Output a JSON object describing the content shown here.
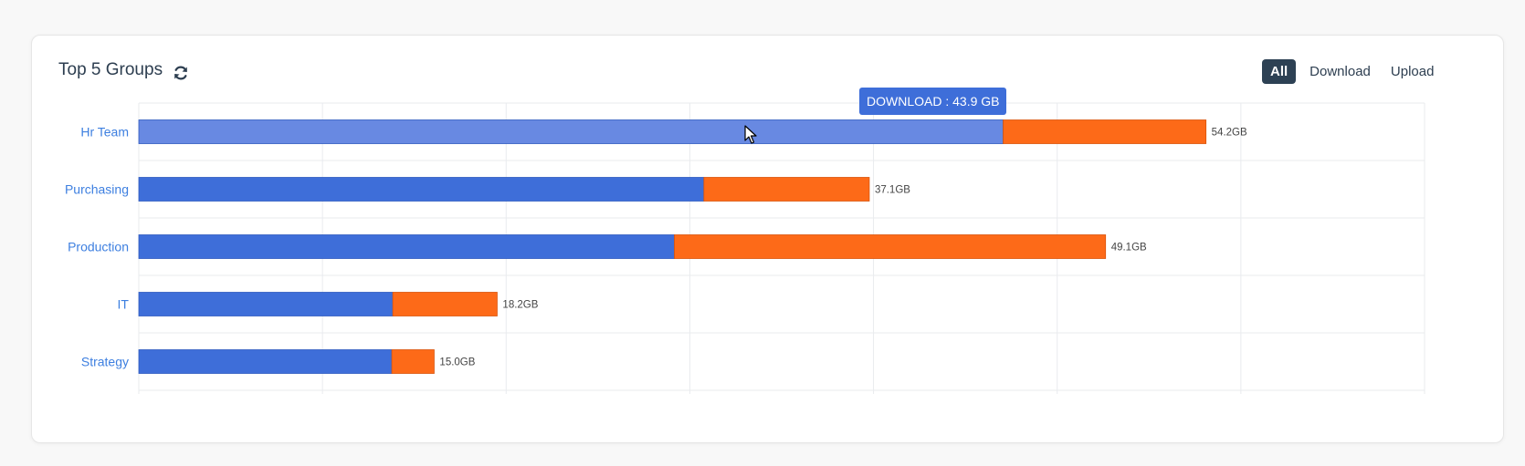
{
  "header": {
    "title": "Top 5 Groups",
    "refresh_icon": "refresh-icon"
  },
  "filters": [
    {
      "label": "All",
      "active": true
    },
    {
      "label": "Download",
      "active": false
    },
    {
      "label": "Upload",
      "active": false
    }
  ],
  "tooltip": {
    "text": "DOWNLOAD : 43.9 GB"
  },
  "colors": {
    "download": "#3e6ed9",
    "download_hover": "#6889e2",
    "upload": "#fd6a18",
    "grid": "#e9ebee",
    "category_label": "#3d7fe0",
    "value_label": "#444444"
  },
  "chart_data": {
    "type": "bar",
    "orientation": "horizontal",
    "stacked": true,
    "categories": [
      "Hr Team",
      "Purchasing",
      "Production",
      "IT",
      "Strategy"
    ],
    "series": [
      {
        "name": "DOWNLOAD",
        "values": [
          43.9,
          28.7,
          27.2,
          12.9,
          12.85
        ]
      },
      {
        "name": "UPLOAD",
        "values": [
          10.3,
          8.4,
          21.9,
          5.3,
          2.15
        ]
      }
    ],
    "totals": [
      "54.2GB",
      "37.1GB",
      "49.1GB",
      "18.2GB",
      "15.0GB"
    ],
    "xlim": [
      0,
      65.3
    ],
    "grid": true,
    "highlighted": {
      "category": "Hr Team",
      "series": "DOWNLOAD"
    }
  }
}
